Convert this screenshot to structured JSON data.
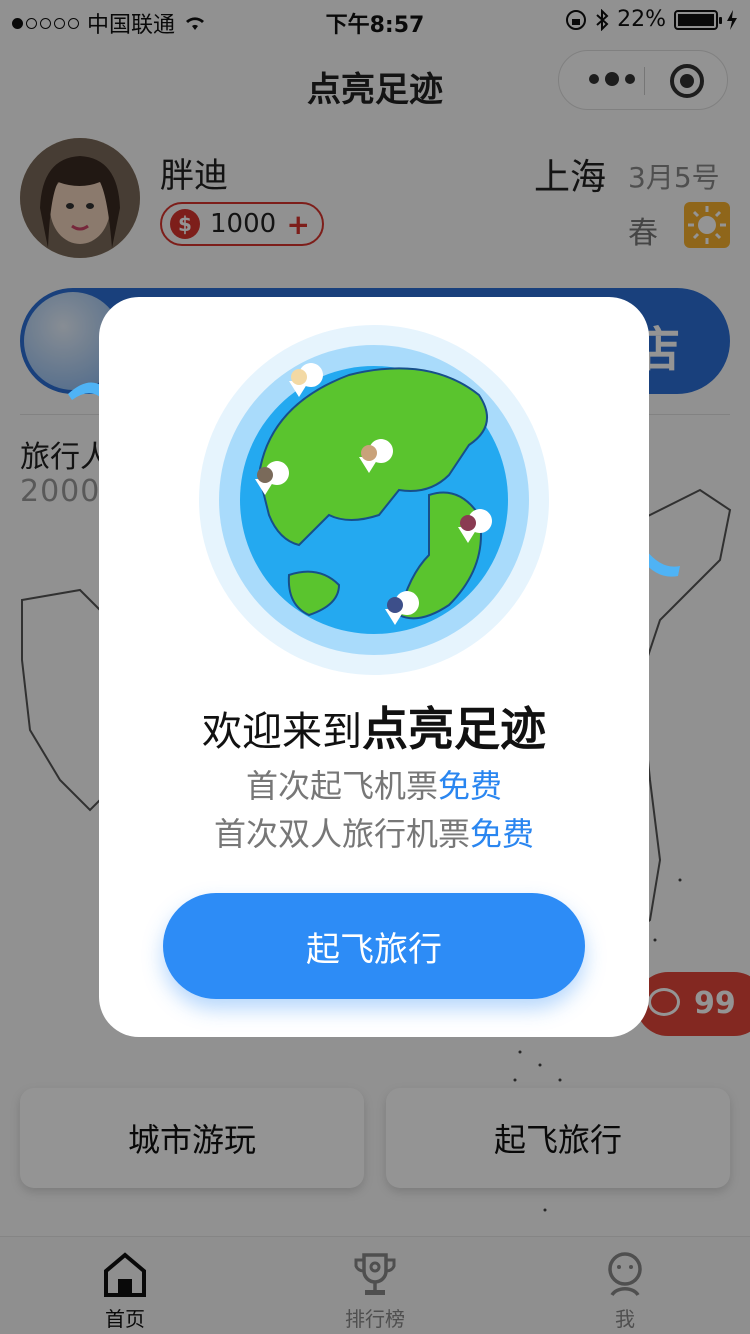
{
  "status_bar": {
    "carrier": "中国联通",
    "time": "下午8:57",
    "battery": "22%",
    "signal_dots": [
      true,
      false,
      false,
      false,
      false
    ]
  },
  "nav": {
    "title": "点亮足迹"
  },
  "profile": {
    "name": "胖迪",
    "coins": "1000",
    "coin_symbol": "$",
    "coin_add": "+",
    "city": "上海",
    "date": "3月5号",
    "season": "春"
  },
  "banner": {
    "label": "店"
  },
  "travelers": {
    "label": "旅行人",
    "count": "2000"
  },
  "chat": {
    "count": "99"
  },
  "actions": {
    "city_play": "城市游玩",
    "take_off": "起飞旅行"
  },
  "tabs": [
    {
      "label": "首页",
      "icon": "home-icon",
      "active": true
    },
    {
      "label": "排行榜",
      "icon": "trophy-icon",
      "active": false
    },
    {
      "label": "我",
      "icon": "user-icon",
      "active": false
    }
  ],
  "modal": {
    "welcome_prefix": "欢迎来到",
    "welcome_brand": "点亮足迹",
    "line1_prefix": "首次起飞机票",
    "line1_highlight": "免费",
    "line2_prefix": "首次双人旅行机票",
    "line2_highlight": "免费",
    "button": "起飞旅行"
  },
  "colors": {
    "accent": "#2d8cf6",
    "coin_red": "#d8342e",
    "globe_ocean": "#22aaf0",
    "globe_land": "#5ac42e"
  }
}
